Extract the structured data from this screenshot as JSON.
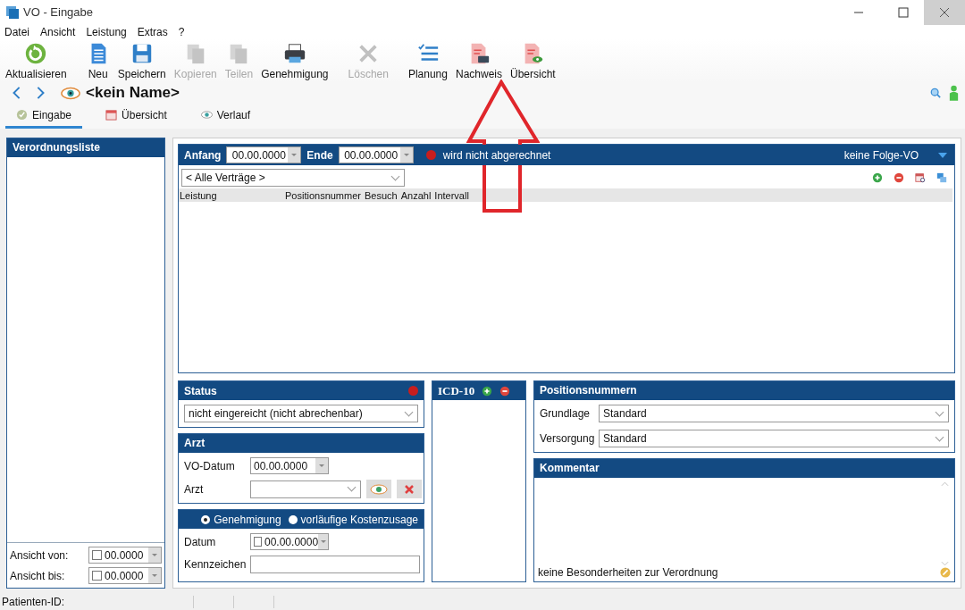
{
  "window": {
    "title": "VO - Eingabe"
  },
  "menu": [
    {
      "label": "Datei"
    },
    {
      "label": "Ansicht"
    },
    {
      "label": "Leistung"
    },
    {
      "label": "Extras"
    },
    {
      "label": "?"
    }
  ],
  "toolbar_groups": [
    [
      {
        "label": "Aktualisieren",
        "kind": "refresh",
        "disabled": false
      }
    ],
    [
      {
        "label": "Neu",
        "kind": "document",
        "disabled": false
      },
      {
        "label": "Speichern",
        "kind": "save",
        "disabled": false
      },
      {
        "label": "Kopieren",
        "kind": "copy",
        "disabled": true
      },
      {
        "label": "Teilen",
        "kind": "copy",
        "disabled": true
      },
      {
        "label": "Genehmigung",
        "kind": "printer",
        "disabled": false
      }
    ],
    [
      {
        "label": "Löschen",
        "kind": "delete",
        "disabled": true
      }
    ],
    [
      {
        "label": "Planung",
        "kind": "checklist",
        "disabled": false
      },
      {
        "label": "Nachweis",
        "kind": "pdf-printer",
        "disabled": false
      },
      {
        "label": "Übersicht",
        "kind": "pdf-eye",
        "disabled": false
      }
    ]
  ],
  "record": {
    "name": "<kein Name>"
  },
  "tabs": [
    {
      "label": "Eingabe",
      "kind": "check",
      "selected": true
    },
    {
      "label": "Übersicht",
      "kind": "calendar",
      "selected": false
    },
    {
      "label": "Verlauf",
      "kind": "eye",
      "selected": false
    }
  ],
  "sidebar": {
    "title": "Verordnungsliste",
    "filters": [
      {
        "label": "Ansicht von:",
        "value": "00.0000",
        "checked": false
      },
      {
        "label": "Ansicht bis:",
        "value": "00.0000",
        "checked": false
      }
    ]
  },
  "services": {
    "start_label": "Anfang",
    "start": "00.00.0000",
    "end_label": "Ende",
    "end": "00.00.0000",
    "billing_text": "wird nicht abgerechnet",
    "followup": "keine Folge-VO",
    "contract": "< Alle Verträge >",
    "columns": [
      "Leistung",
      "Positionsnummer",
      "Besuch",
      "Anzahl",
      "Intervall"
    ]
  },
  "status": {
    "title": "Status",
    "value": "nicht eingereicht (nicht abrechenbar)"
  },
  "doctor": {
    "title": "Arzt",
    "date_label": "VO-Datum",
    "date": "00.00.0000",
    "doctor_label": "Arzt"
  },
  "approval": {
    "options": [
      {
        "label": "Genehmigung",
        "selected": true
      },
      {
        "label": "vorläufige Kostenzusage",
        "selected": false
      }
    ],
    "date_label": "Datum",
    "date": "00.00.0000",
    "date_checked": false,
    "code_label": "Kennzeichen"
  },
  "icd": {
    "title": "ICD-10"
  },
  "positions": {
    "title": "Positionsnummern",
    "fields": [
      {
        "label": "Grundlage",
        "value": "Standard"
      },
      {
        "label": "Versorgung",
        "value": "Standard"
      }
    ]
  },
  "comment": {
    "title": "Kommentar",
    "text": "keine Besonderheiten zur Verordnung"
  },
  "status_bar": {
    "patient_label": "Patienten-ID:"
  }
}
